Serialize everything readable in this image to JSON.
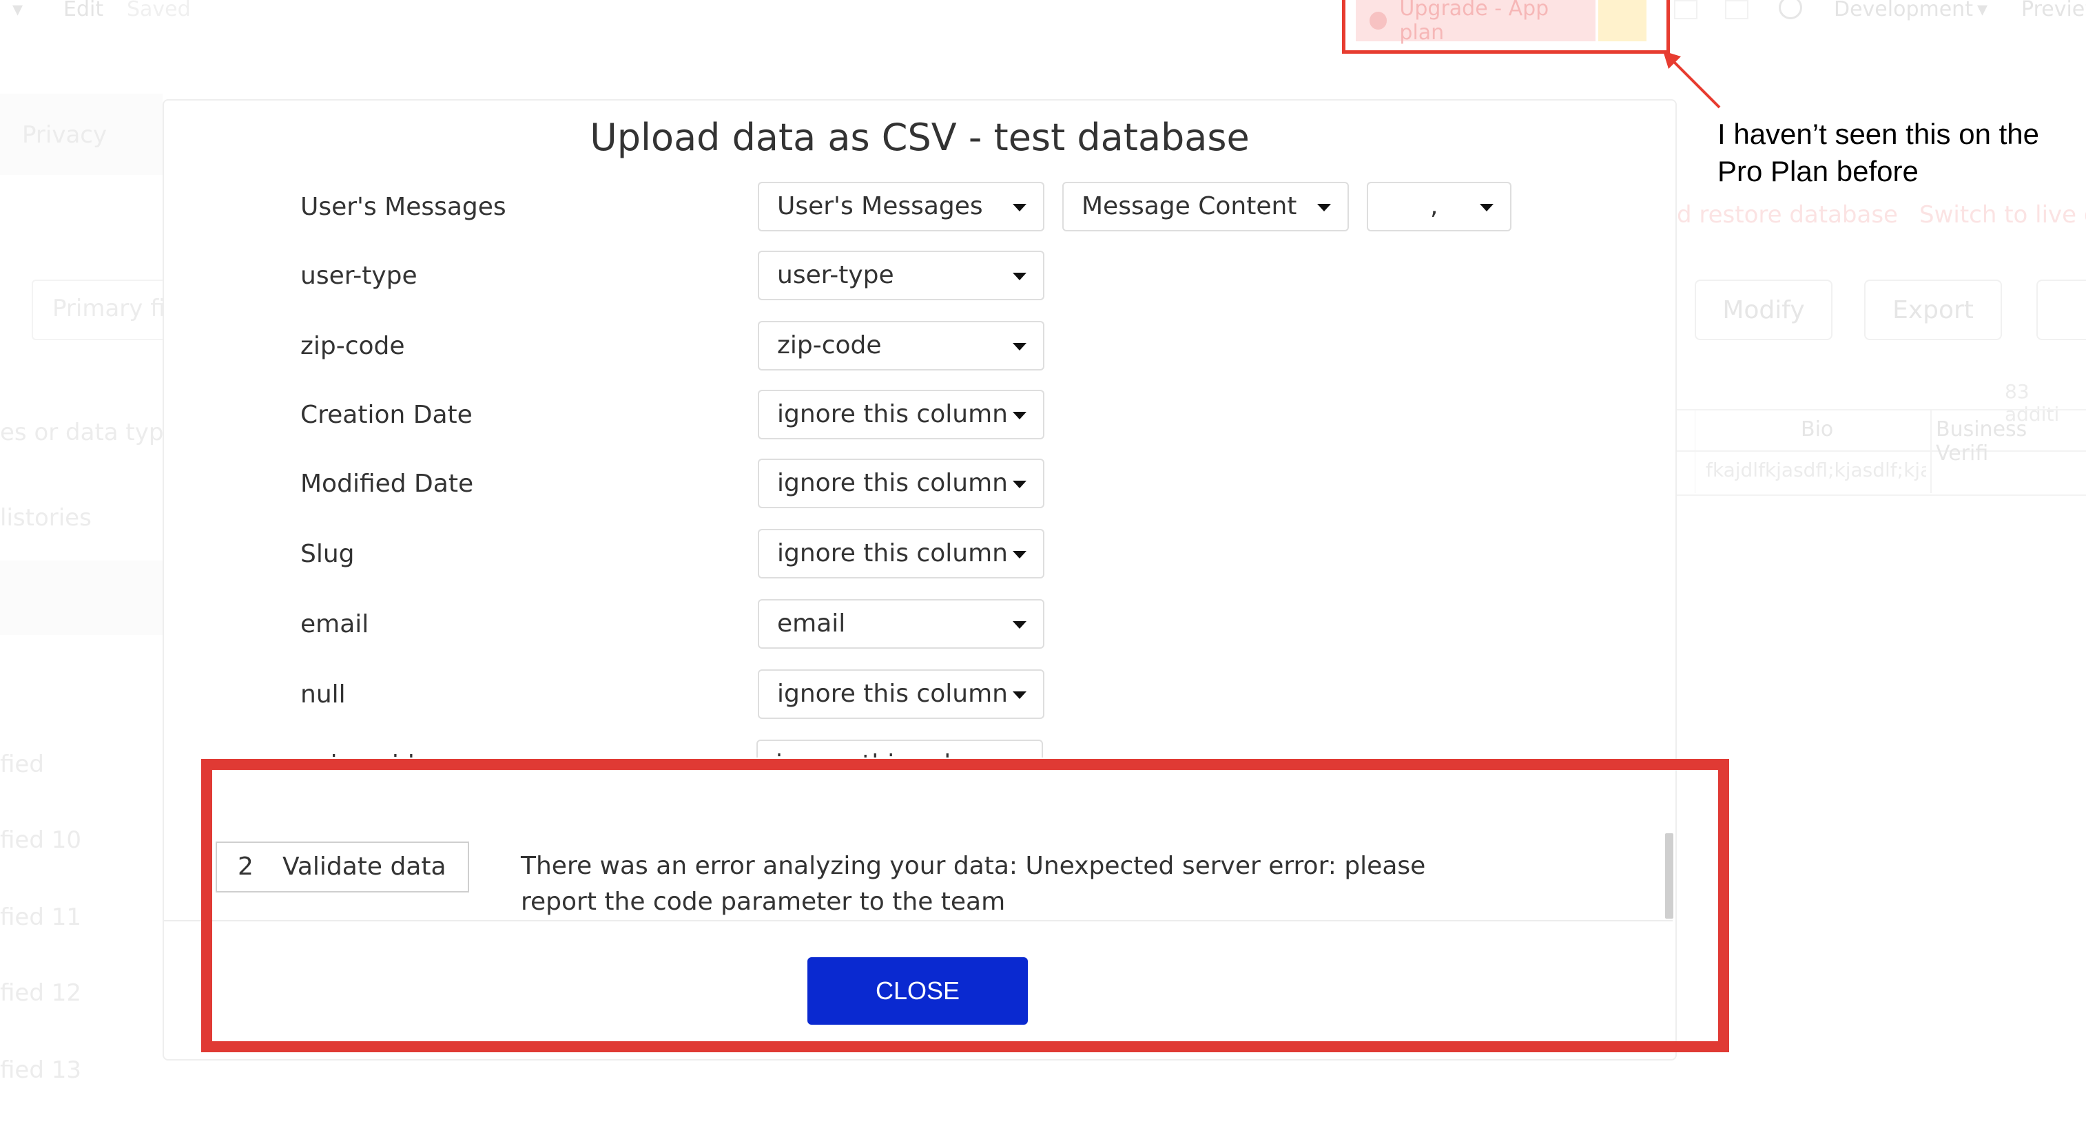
{
  "topbar": {
    "edit": "Edit",
    "saved": "Saved",
    "upgrade": "Upgrade - App plan",
    "environment": "Development",
    "preview": "Preview"
  },
  "background": {
    "privacy": "Privacy",
    "primary_field": "Primary fi",
    "data_types": "es or data types",
    "histories": "listories",
    "restore": "d restore database",
    "switch_live": "Switch to live d",
    "modify": "Modify",
    "export": "Export",
    "additional": "83 additi",
    "col_bio": "Bio",
    "col_business": "Business Verifi",
    "cell_bio": "fkajdlfkjasdfl;kjasdlf;kja",
    "left_items": [
      "fied",
      "fied 10",
      "fied 11",
      "fied 12",
      "fied 13"
    ]
  },
  "annotation": {
    "line1": "I haven’t seen this on the",
    "line2": "Pro Plan before",
    "color": "#e73c30"
  },
  "modal": {
    "title": "Upload data as CSV - test database",
    "rows": [
      {
        "label": "User's Messages",
        "field": "User's Messages",
        "sub": "Message Content",
        "sep": ","
      },
      {
        "label": "user-type",
        "field": "user-type"
      },
      {
        "label": "zip-code",
        "field": "zip-code"
      },
      {
        "label": "Creation Date",
        "field": "ignore this column"
      },
      {
        "label": "Modified Date",
        "field": "ignore this column"
      },
      {
        "label": "Slug",
        "field": "ignore this column"
      },
      {
        "label": "email",
        "field": "email"
      },
      {
        "label": "null",
        "field": "ignore this column"
      },
      {
        "label": "unique id",
        "field": "ignore this column"
      }
    ],
    "step": {
      "number": "2",
      "label": "Validate data"
    },
    "error": "There was an error analyzing your data: Unexpected server error: please report the code parameter to the team",
    "close": "CLOSE",
    "accent": "#0a29d0"
  }
}
